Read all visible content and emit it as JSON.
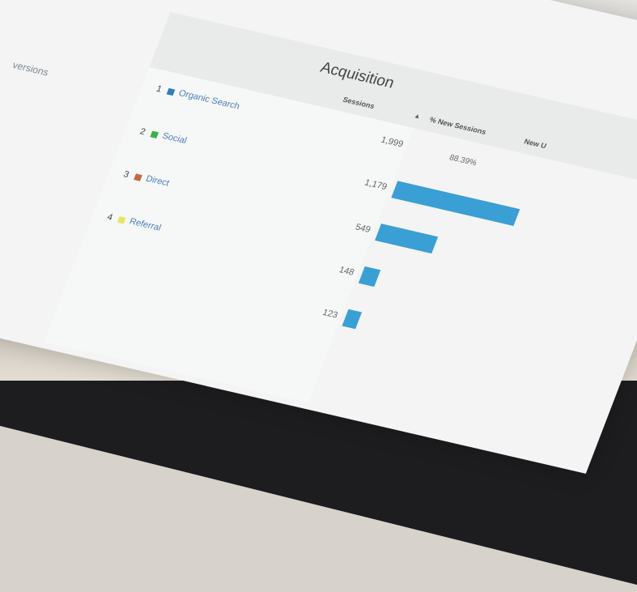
{
  "sidebar_label": "versions",
  "table": {
    "group_title": "Acquisition",
    "columns": [
      "Sessions",
      "% New Sessions",
      "New U"
    ],
    "rows": [
      {
        "rank": "1",
        "channel": "Organic Search",
        "sessions": "1,999",
        "new_sessions_pct": "88.39%",
        "color": "#2f7fb8"
      },
      {
        "rank": "2",
        "channel": "Social",
        "sessions": "1,179",
        "color": "#3bb14a"
      },
      {
        "rank": "3",
        "channel": "Direct",
        "sessions": "549",
        "color": "#c46a45"
      },
      {
        "rank": "4",
        "channel": "Referral",
        "sessions": "148",
        "color": "#e6e36a"
      },
      {
        "sessions": "123"
      }
    ]
  }
}
